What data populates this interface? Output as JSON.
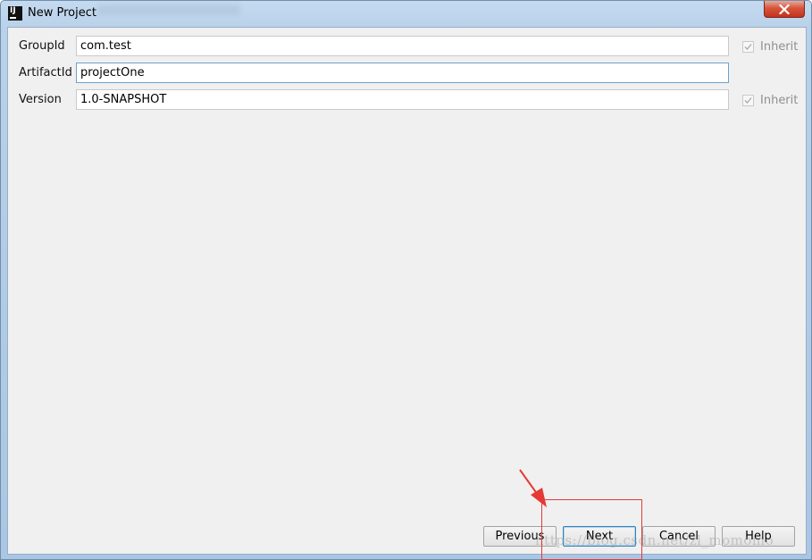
{
  "window": {
    "title": "New Project",
    "app_icon_text": "IJ"
  },
  "form": {
    "rows": [
      {
        "label": "GroupId",
        "value": "com.test",
        "inherit_label": "Inherit",
        "inherit_checked": true
      },
      {
        "label": "ArtifactId",
        "value": "projectOne"
      },
      {
        "label": "Version",
        "value": "1.0-SNAPSHOT",
        "inherit_label": "Inherit",
        "inherit_checked": true
      }
    ]
  },
  "buttons": {
    "previous": "Previous",
    "next": "Next",
    "cancel": "Cancel",
    "help": "Help"
  },
  "watermark": "https://blog.csdn.net/zl_momomo",
  "colors": {
    "highlight": "#e53935",
    "focus_border": "#6ea2cd",
    "default_button_border": "#3c7fb1"
  }
}
